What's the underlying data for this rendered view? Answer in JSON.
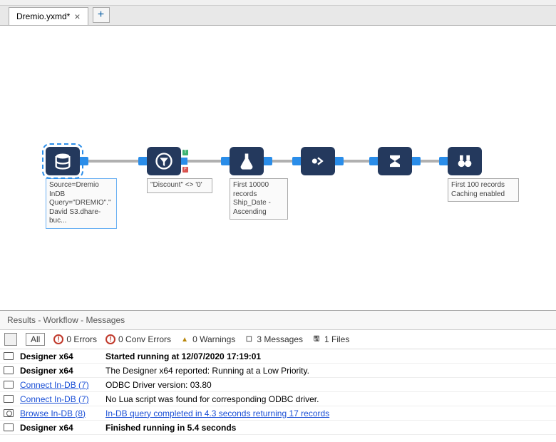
{
  "tab": {
    "title": "Dremio.yxmd*"
  },
  "nodes": {
    "n1": {
      "label": "Source=Dremio InDB Query=\"DREMIO\".\"David S3.dhare-buc..."
    },
    "n2": {
      "label": "\"Discount\" <> '0'"
    },
    "n3": {
      "label": "First 10000 records\nShip_Date - Ascending"
    },
    "n6": {
      "label": "First 100 records Caching enabled"
    }
  },
  "results": {
    "header": "Results - Workflow - Messages",
    "filters": {
      "all": "All",
      "errors": "0 Errors",
      "conv": "0 Conv Errors",
      "warnings": "0 Warnings",
      "messages": "3 Messages",
      "files": "1 Files"
    },
    "rows": [
      {
        "icon": "msg",
        "src": "Designer x64",
        "srcBold": true,
        "txt": "Started running at 12/07/2020 17:19:01",
        "txtBold": true
      },
      {
        "icon": "msg",
        "src": "Designer x64",
        "srcBold": true,
        "txt": "The Designer x64 reported: Running at a Low Priority."
      },
      {
        "icon": "msg",
        "src": "Connect In-DB (7)",
        "srcLink": true,
        "txt": "ODBC Driver version: 03.80"
      },
      {
        "icon": "msg",
        "src": "Connect In-DB (7)",
        "srcLink": true,
        "txt": "No Lua script was found for corresponding ODBC driver."
      },
      {
        "icon": "file",
        "src": "Browse In-DB (8)",
        "srcLink": true,
        "txt": "In-DB query completed in 4.3 seconds returning 17 records",
        "txtLink": true
      },
      {
        "icon": "msg",
        "src": "Designer x64",
        "srcBold": true,
        "txt": "Finished running in 5.4 seconds",
        "txtBold": true
      }
    ]
  }
}
